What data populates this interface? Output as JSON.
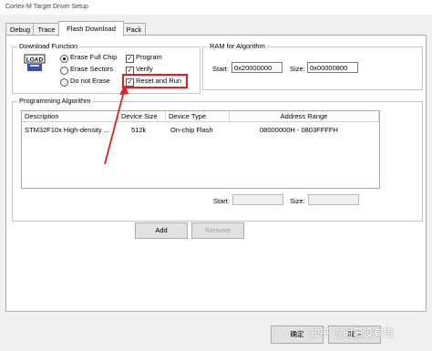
{
  "window": {
    "title": "Cortex-M Target Driver Setup"
  },
  "tabs": [
    {
      "label": "Debug"
    },
    {
      "label": "Trace"
    },
    {
      "label": "Flash Download",
      "active": true
    },
    {
      "label": "Pack"
    }
  ],
  "download_function": {
    "legend": "Download Function",
    "icon_text": "LOAD",
    "radios": [
      {
        "label": "Erase Full Chip",
        "checked": true
      },
      {
        "label": "Erase Sectors",
        "checked": false
      },
      {
        "label": "Do not Erase",
        "checked": false
      }
    ],
    "checks": [
      {
        "label": "Program",
        "checked": true
      },
      {
        "label": "Verify",
        "checked": true
      },
      {
        "label": "Reset and Run",
        "checked": true
      }
    ]
  },
  "ram": {
    "legend": "RAM for Algorithm",
    "start_label": "Start:",
    "start_value": "0x20000000",
    "size_label": "Size:",
    "size_value": "0x00000800"
  },
  "programming": {
    "legend": "Programming Algorithm",
    "columns": [
      "Description",
      "Device Size",
      "Device Type",
      "Address Range"
    ],
    "rows": [
      [
        "STM32F10x High-density ...",
        "512k",
        "On-chip Flash",
        "08000000H - 0803FFFFH"
      ]
    ],
    "start_label": "Start:",
    "start_value": "",
    "size_label": "Size:",
    "size_value": "",
    "add_label": "Add",
    "remove_label": "Remove"
  },
  "footer": {
    "ok_label": "确定",
    "cancel_label": "取消",
    "watermark": "知乎 @时暑没有错"
  },
  "colors": {
    "highlight": "#e02020",
    "dialog_bg": "#f0f0f0"
  }
}
